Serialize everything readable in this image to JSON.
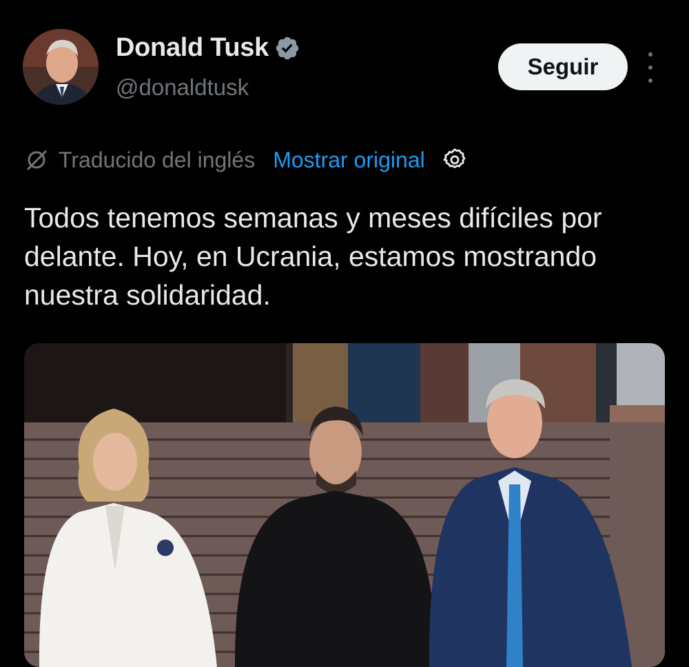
{
  "author": {
    "display_name": "Donald Tusk",
    "handle": "@donaldtusk",
    "verified": true,
    "verified_color": "#71767b"
  },
  "actions": {
    "follow_label": "Seguir",
    "more_icon": "more-vertical-icon"
  },
  "translation": {
    "label": "Traducido del inglés",
    "show_original_label": "Mostrar original",
    "link_color": "#1d9bf0",
    "icons": [
      "translate-icon",
      "settings-icon"
    ]
  },
  "tweet": {
    "text": "Todos tenemos semanas y meses difíciles por delante. Hoy, en Ucrania, estamos mostrando nuestra solidaridad."
  },
  "media": {
    "type": "photo",
    "icon": "photo"
  },
  "theme": {
    "background": "#000000",
    "text": "#e7e9ea",
    "secondary": "#71767b"
  }
}
